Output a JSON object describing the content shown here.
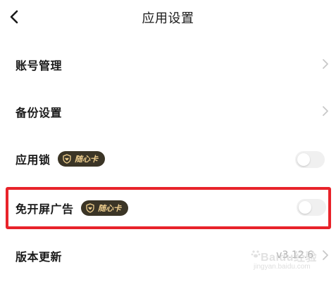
{
  "header": {
    "title": "应用设置",
    "back_icon": "chevron-left-icon"
  },
  "rows": [
    {
      "label": "账号管理",
      "control": "chevron"
    },
    {
      "label": "备份设置",
      "control": "chevron"
    },
    {
      "label": "应用锁",
      "badge": "随心卡",
      "control": "toggle",
      "toggle_on": false
    },
    {
      "label": "免开屏广告",
      "badge": "随心卡",
      "control": "toggle",
      "toggle_on": false,
      "highlighted": true
    },
    {
      "label": "版本更新",
      "value": "v3.12.6",
      "control": "chevron"
    }
  ],
  "colors": {
    "badge_bg": "#3b3526",
    "badge_text": "#f0d08f",
    "highlight": "#e8232a",
    "toggle_off": "#f0f0f0"
  },
  "watermark": {
    "line1": "Baidu经验",
    "line2": "jingyan.baidu.com"
  }
}
